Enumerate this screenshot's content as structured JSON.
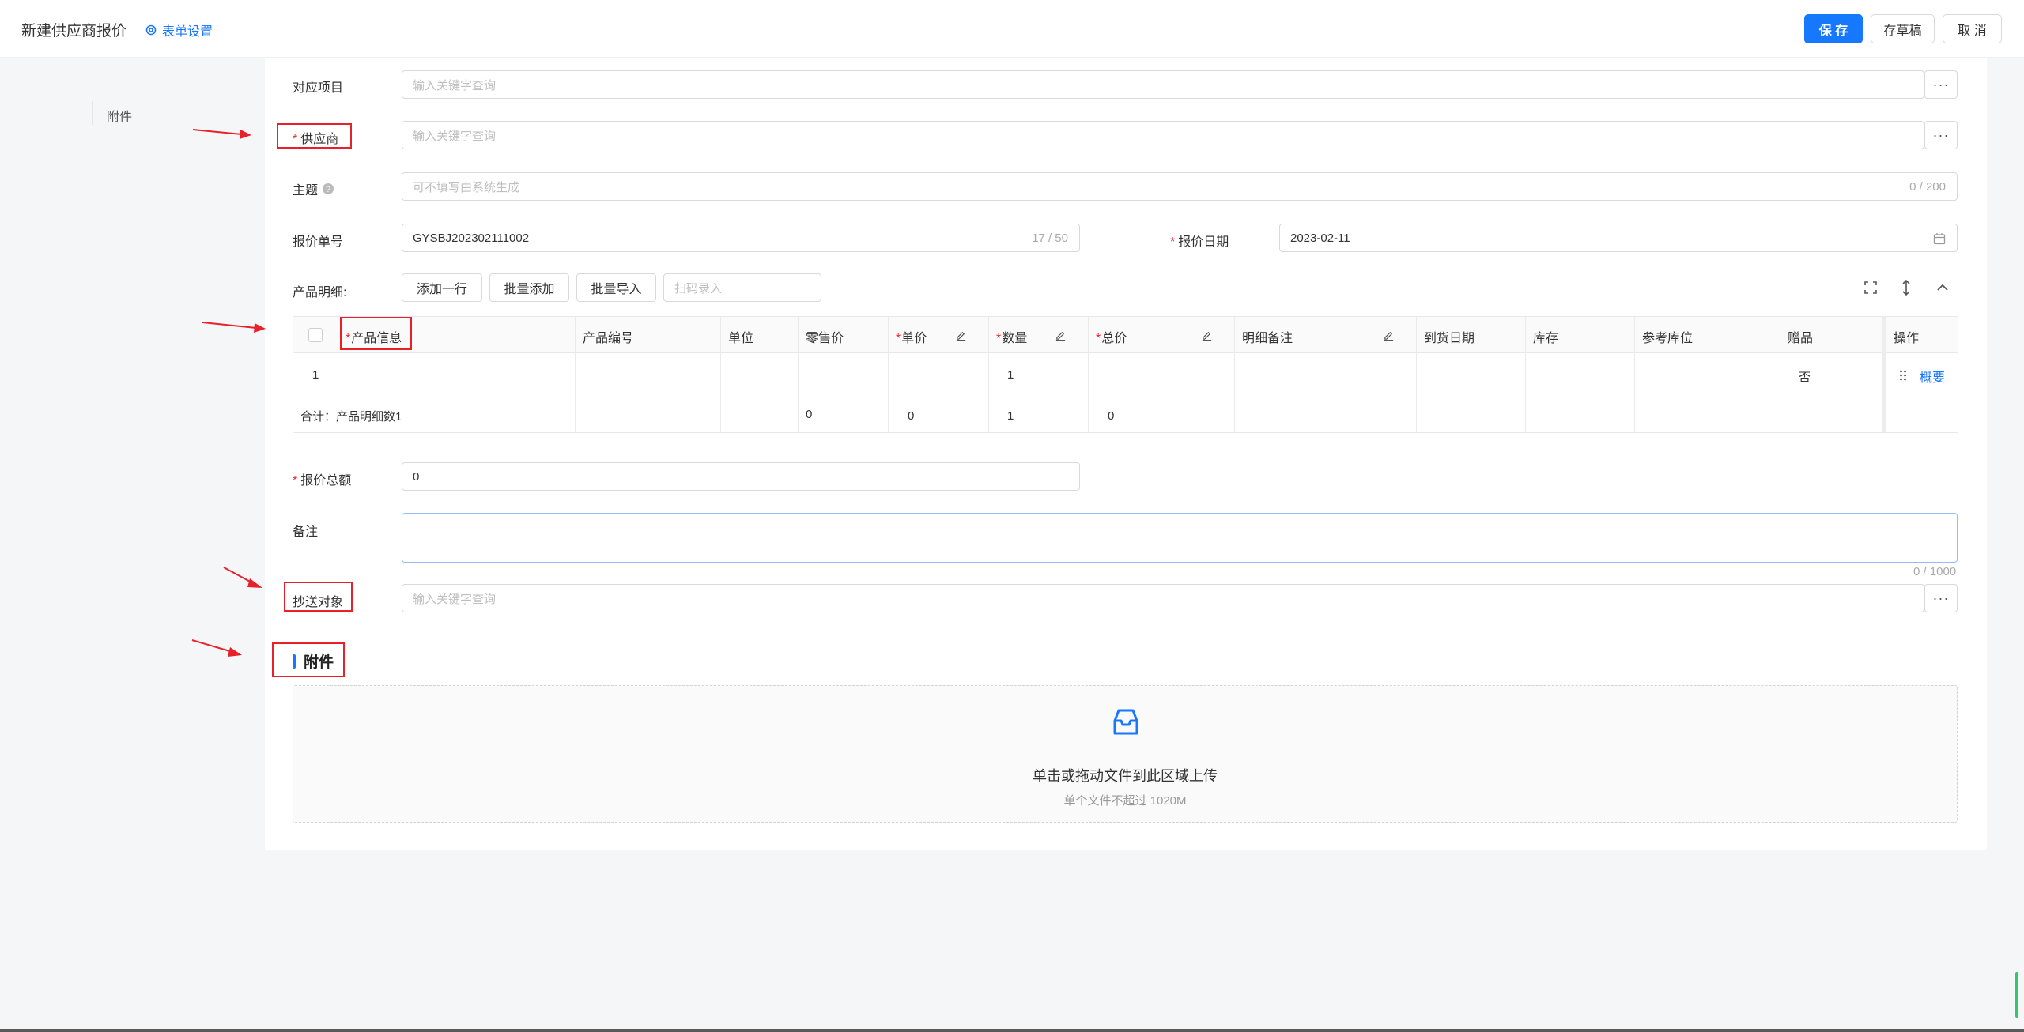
{
  "header": {
    "title": "新建供应商报价",
    "form_settings": "表单设置",
    "save": "保 存",
    "draft": "存草稿",
    "cancel": "取 消"
  },
  "sidenav": {
    "attachment": "附件"
  },
  "form": {
    "project_label": "对应项目",
    "project_placeholder": "输入关键字查询",
    "supplier_label": "供应商",
    "supplier_placeholder": "输入关键字查询",
    "subject_label": "主题",
    "subject_placeholder": "可不填写由系统生成",
    "subject_count": "0 / 200",
    "quote_no_label": "报价单号",
    "quote_no_value": "GYSBJ202302111002",
    "quote_no_count": "17 / 50",
    "quote_date_label": "报价日期",
    "quote_date_value": "2023-02-11",
    "details_label": "产品明细:",
    "add_row": "添加一行",
    "batch_add": "批量添加",
    "batch_import": "批量导入",
    "scan_placeholder": "扫码录入",
    "total_label": "报价总额",
    "total_value": "0",
    "remark_label": "备注",
    "remark_count": "0 / 1000",
    "cc_label": "抄送对象",
    "cc_placeholder": "输入关键字查询",
    "attachment_title": "附件",
    "upload_text": "单击或拖动文件到此区域上传",
    "upload_hint": "单个文件不超过 1020M"
  },
  "table": {
    "columns": [
      "产品信息",
      "产品编号",
      "单位",
      "零售价",
      "单价",
      "数量",
      "总价",
      "明细备注",
      "到货日期",
      "库存",
      "参考库位",
      "赠品",
      "操作"
    ],
    "row": {
      "index": "1",
      "qty": "1",
      "gift": "否",
      "action": "概要"
    },
    "summary": {
      "label": "合计：产品明细数1",
      "retail": "0",
      "price": "0",
      "qty": "1",
      "total": "0"
    }
  },
  "colors": {
    "primary": "#1677ff",
    "required": "#f5222d",
    "annotation": "#e8202a"
  },
  "icons": [
    "settings-icon",
    "more-dots-icon",
    "help-icon",
    "calendar-icon",
    "fullscreen-icon",
    "row-height-icon",
    "collapse-icon",
    "edit-icon",
    "drag-handle-icon",
    "inbox-icon",
    "arrow-icon"
  ]
}
